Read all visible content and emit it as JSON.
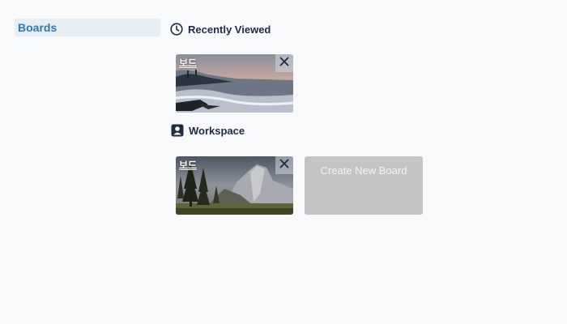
{
  "sidebar": {
    "items": [
      {
        "label": "Boards"
      }
    ]
  },
  "sections": {
    "recent": {
      "title": "Recently Viewed",
      "icon": "clock-icon"
    },
    "workspace": {
      "title": "Workspace",
      "icon": "person-icon"
    }
  },
  "recent_boards": [
    {
      "title": "보드",
      "background": "ocean-sunset-photo"
    }
  ],
  "workspace_boards": [
    {
      "title": "보드",
      "background": "mountain-forest-photo"
    }
  ],
  "create_board": {
    "label": "Create New Board"
  },
  "colors": {
    "accent": "#2f77b3",
    "sidebar_active_bg": "#e6edf3",
    "heading": "#1f2a44",
    "create_tile_bg": "#c4c4c4",
    "page_bg": "#f8f9fb"
  }
}
